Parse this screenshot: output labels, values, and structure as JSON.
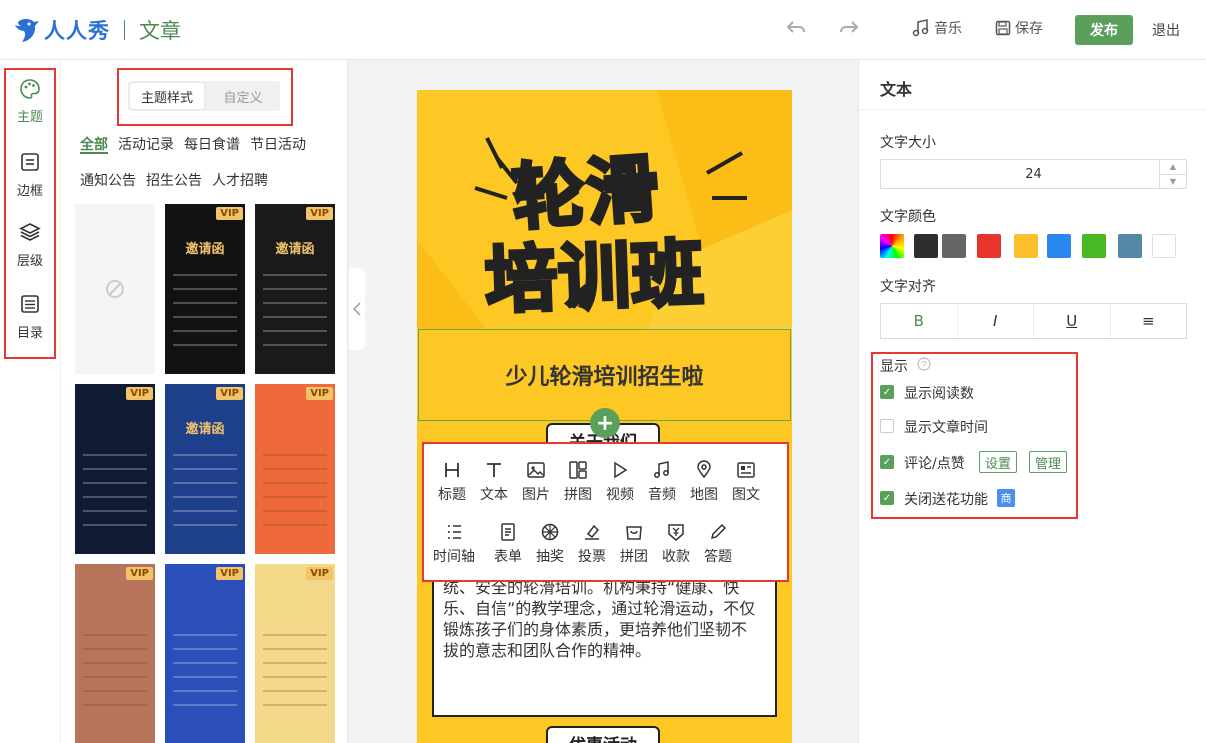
{
  "header": {
    "brand": "人人秀",
    "section": "文章",
    "undo_icon": "undo-icon",
    "redo_icon": "redo-icon",
    "music_label": "音乐",
    "save_label": "保存",
    "publish_label": "发布",
    "exit_label": "退出"
  },
  "leftnav": {
    "items": [
      {
        "label": "主题",
        "icon": "palette-icon",
        "active": true
      },
      {
        "label": "边框",
        "icon": "frame-icon",
        "active": false
      },
      {
        "label": "层级",
        "icon": "layers-icon",
        "active": false
      },
      {
        "label": "目录",
        "icon": "list-icon",
        "active": false
      }
    ]
  },
  "theme_panel": {
    "segments": [
      "主题样式",
      "自定义"
    ],
    "categories_row1": [
      "全部",
      "活动记录",
      "每日食谱",
      "节日活动"
    ],
    "categories_row2": [
      "通知公告",
      "招生公告",
      "人才招聘"
    ],
    "vip_label": "VIP",
    "thumbs": [
      {
        "title": "",
        "bg": "#f5f5f5",
        "vip": false,
        "none": true
      },
      {
        "title": "邀请函",
        "bg": "#121212",
        "vip": true,
        "none": false
      },
      {
        "title": "邀请函",
        "bg": "#1a1a1a",
        "vip": true,
        "none": false
      },
      {
        "title": "",
        "bg": "#0f1a33",
        "vip": true,
        "none": false
      },
      {
        "title": "邀请函",
        "bg": "#1e3f8a",
        "vip": true,
        "none": false
      },
      {
        "title": "",
        "bg": "#ef6a3a",
        "vip": true,
        "none": false
      },
      {
        "title": "",
        "bg": "#b8745a",
        "vip": true,
        "none": false
      },
      {
        "title": "",
        "bg": "#2a4fb8",
        "vip": true,
        "none": false
      },
      {
        "title": "",
        "bg": "#f5d98a",
        "vip": true,
        "none": false
      }
    ]
  },
  "canvas": {
    "hero_line1": "轮滑",
    "hero_line2": "培训班",
    "subtitle": "少儿轮滑培训招生啦",
    "about_pill": "关于我们",
    "body_text": "统、安全的轮滑培训。机构秉持“健康、快乐、自信”的教学理念，通过轮滑运动，不仅锻炼孩子们的身体素质，更培养他们坚韧不拔的意志和团队合作的精神。",
    "promo_pill": "优惠活动"
  },
  "insert_toolbar": {
    "row1": [
      {
        "label": "标题",
        "icon": "heading-icon"
      },
      {
        "label": "文本",
        "icon": "text-icon"
      },
      {
        "label": "图片",
        "icon": "image-icon"
      },
      {
        "label": "拼图",
        "icon": "collage-icon"
      },
      {
        "label": "视频",
        "icon": "video-icon"
      },
      {
        "label": "音频",
        "icon": "audio-icon"
      },
      {
        "label": "地图",
        "icon": "map-icon"
      },
      {
        "label": "图文",
        "icon": "image-text-icon"
      }
    ],
    "row2": [
      {
        "label": "时间轴",
        "icon": "timeline-icon"
      },
      {
        "label": "表单",
        "icon": "form-icon"
      },
      {
        "label": "抽奖",
        "icon": "lottery-icon"
      },
      {
        "label": "投票",
        "icon": "vote-icon"
      },
      {
        "label": "拼团",
        "icon": "group-buy-icon"
      },
      {
        "label": "收款",
        "icon": "payment-icon"
      },
      {
        "label": "答题",
        "icon": "quiz-icon"
      }
    ]
  },
  "props": {
    "title": "文本",
    "font_size_label": "文字大小",
    "font_size_value": "24",
    "font_color_label": "文字颜色",
    "colors": [
      "#2e2e2e",
      "#666666",
      "#e8352c",
      "#fbbf2d",
      "#2a86f0",
      "#49b925",
      "#5587a6",
      "#ffffff"
    ],
    "align_label": "文字对齐",
    "align_options": [
      "B",
      "I",
      "U",
      "≡"
    ],
    "display_label": "显示",
    "options": [
      {
        "label": "显示阅读数",
        "checked": true
      },
      {
        "label": "显示文章时间",
        "checked": false
      },
      {
        "label": "评论/点赞",
        "checked": true
      },
      {
        "label": "关闭送花功能",
        "checked": true
      }
    ],
    "settings_btn": "设置",
    "manage_btn": "管理",
    "shang_badge": "商"
  }
}
